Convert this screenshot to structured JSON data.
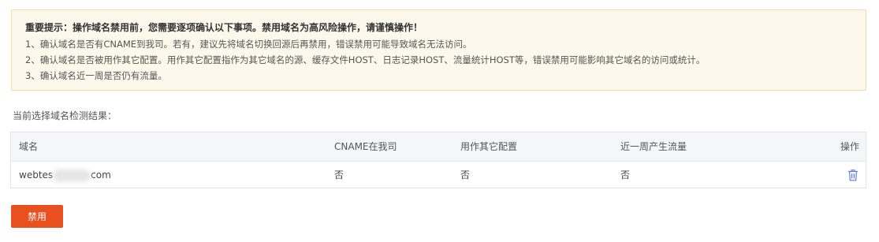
{
  "warning": {
    "title": "重要提示：操作域名禁用前，您需要逐项确认以下事项。禁用域名为高风险操作，请谨慎操作！",
    "items": [
      "1、确认域名是否有CNAME到我司。若有，建议先将域名切换回源后再禁用，错误禁用可能导致域名无法访问。",
      "2、确认域名是否被用作其它配置。用作其它配置指作为其它域名的源、缓存文件HOST、日志记录HOST、流量统计HOST等，错误禁用可能影响其它域名的访问或统计。",
      "3、确认域名近一周是否仍有流量。"
    ]
  },
  "result_label": "当前选择域名检测结果：",
  "table": {
    "headers": [
      "域名",
      "CNAME在我司",
      "用作其它配置",
      "近一周产生流量",
      "操作"
    ],
    "rows": [
      {
        "domain_prefix": "webtes",
        "domain_suffix": "com",
        "cname": "否",
        "config": "否",
        "traffic": "否"
      }
    ]
  },
  "icons": {
    "delete": "trash-icon"
  },
  "colors": {
    "primary_button": "#e8501f",
    "warning_bg": "#fdf8ec",
    "warning_border": "#f4dca6",
    "icon_blue": "#5b7ce6"
  },
  "actions": {
    "disable_label": "禁用"
  }
}
